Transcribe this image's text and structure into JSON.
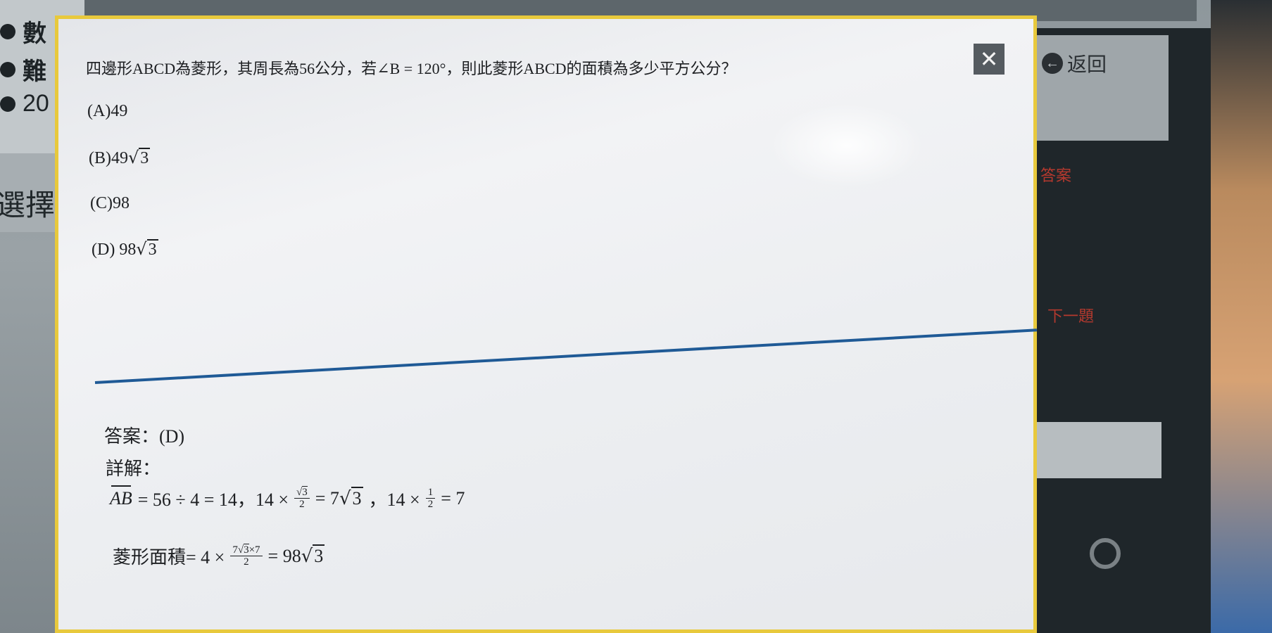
{
  "background": {
    "info_rows": [
      {
        "text": "數"
      },
      {
        "text": "難"
      },
      {
        "text": "20"
      }
    ],
    "select_label": "選擇",
    "back_label": "返回",
    "back_icon": "arrow-left-icon",
    "right_labels": [
      "答案",
      "下一題"
    ]
  },
  "modal": {
    "close_label": "✕",
    "question": "四邊形ABCD為菱形，其周長為56公分，若∠B = 120°，則此菱形ABCD的面積為多少平方公分？",
    "options": [
      {
        "prefix": "(A)49",
        "sqrt": ""
      },
      {
        "prefix": "(B)49",
        "sqrt": "3"
      },
      {
        "prefix": "(C)98",
        "sqrt": ""
      },
      {
        "prefix": "(D) 98",
        "sqrt": "3"
      }
    ],
    "answer": "答案：(D)",
    "explain_label": "詳解：",
    "formula1": {
      "ab": "AB",
      "part1": "= 56 ÷ 4 = 14，14 ×",
      "frac_num_sqrt": "3",
      "frac_den": "2",
      "part2": "= 7",
      "part2_sqrt": "3",
      "part3": "，14 ×",
      "frac2_num": "1",
      "frac2_den": "2",
      "part4": "= 7"
    },
    "formula2": {
      "label": "菱形面積= 4 ×",
      "frac_num_pre": "7",
      "frac_num_sqrt": "3",
      "frac_num_post": "×7",
      "frac_den": "2",
      "result": "= 98",
      "result_sqrt": "3"
    }
  },
  "colors": {
    "modal_border": "#e8c93c",
    "divider": "#1f5a96",
    "close_bg": "#555b60"
  }
}
